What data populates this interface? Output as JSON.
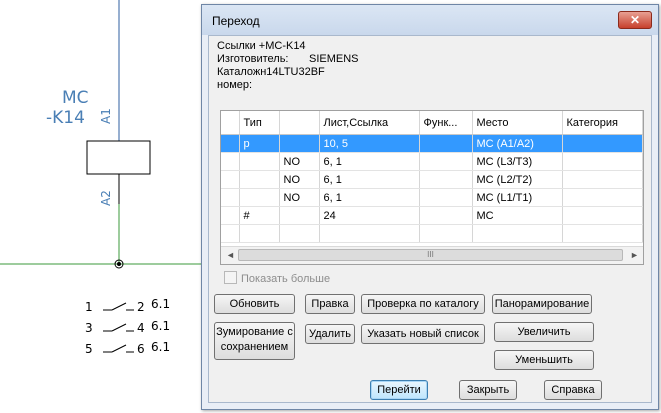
{
  "cad": {
    "symbol_name": "MC",
    "symbol_id": "-K14",
    "pin_top": "A1",
    "pin_bottom": "A2",
    "contacts": [
      {
        "a": "1",
        "b": "2",
        "ref": "6.1"
      },
      {
        "a": "3",
        "b": "4",
        "ref": "6.1"
      },
      {
        "a": "5",
        "b": "6",
        "ref": "6.1"
      }
    ],
    "colors": {
      "wire": "#2f5fa0",
      "green": "#3b9a3b",
      "label": "#4a7fb5"
    }
  },
  "dialog": {
    "title": "Переход",
    "close_glyph": "✕",
    "refs_line": "Ссылки +MC-K14",
    "manufacturer_label": "Изготовитель:",
    "manufacturer_value": "SIEMENS",
    "catalog_label": "Каталожн14LTU32BF",
    "number_label": "номер:",
    "table": {
      "headers": [
        "",
        "Тип",
        "",
        "Лист,Ссылка",
        "Функ...",
        "Место",
        "Категория"
      ],
      "rows": [
        [
          "",
          "p",
          "",
          "10, 5",
          "",
          "MC (A1/A2)",
          ""
        ],
        [
          "",
          "",
          "NO",
          "6, 1",
          "",
          "MC (L3/T3)",
          ""
        ],
        [
          "",
          "",
          "NO",
          "6, 1",
          "",
          "MC (L2/T2)",
          ""
        ],
        [
          "",
          "",
          "NO",
          "6, 1",
          "",
          "MC (L1/T1)",
          ""
        ],
        [
          "",
          "#",
          "",
          "24",
          "",
          "MC",
          ""
        ],
        [
          "",
          "",
          "",
          "",
          "",
          "",
          ""
        ]
      ],
      "selected_row": 0,
      "scroll_left": "◄",
      "scroll_right": "►",
      "scroll_grip": "III"
    },
    "show_more_label": "Показать больше",
    "buttons": {
      "refresh": "Обновить",
      "zoom_save": "Зумирование с сохранением",
      "edit": "Правка",
      "delete": "Удалить",
      "catalog_check": "Проверка по каталогу",
      "new_list": "Указать новый список",
      "pan": "Панорамирование",
      "zoom_in": "Увеличить",
      "zoom_out": "Уменьшить",
      "goto": "Перейти",
      "close": "Закрыть",
      "help": "Справка"
    }
  }
}
